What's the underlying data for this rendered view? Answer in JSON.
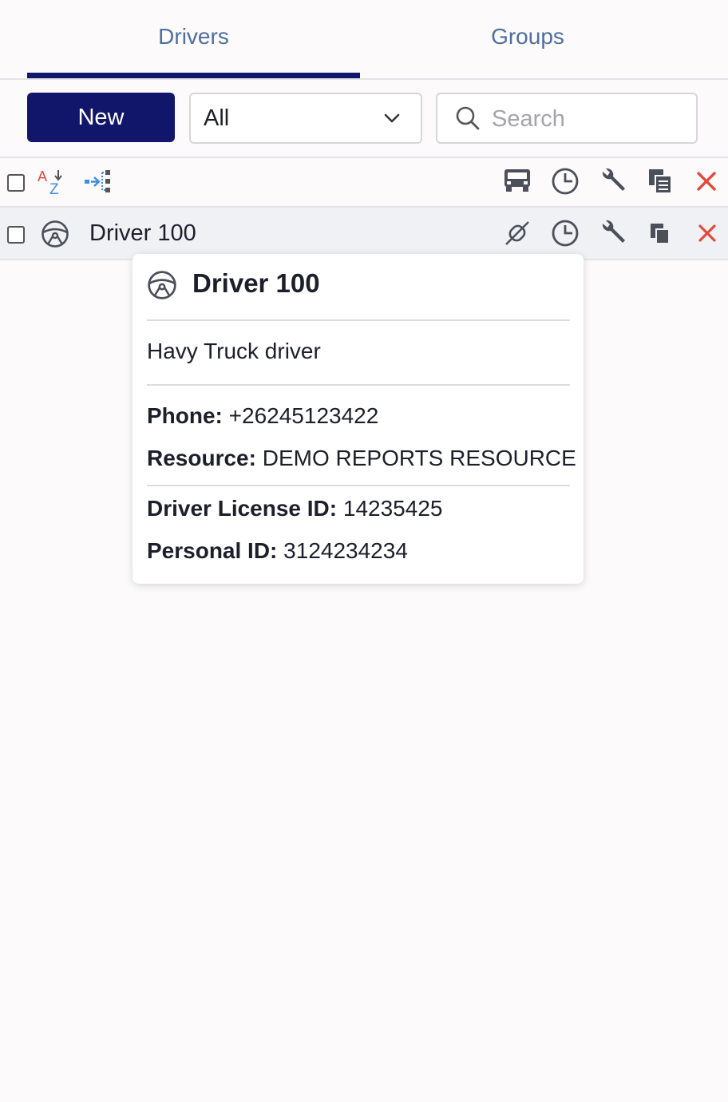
{
  "tabs": [
    {
      "label": "Drivers",
      "active": true
    },
    {
      "label": "Groups",
      "active": false
    }
  ],
  "toolbar": {
    "new_label": "New",
    "filter_value": "All",
    "search_placeholder": "Search"
  },
  "list": {
    "rows": [
      {
        "name": "Driver 100"
      }
    ]
  },
  "tooltip": {
    "title": "Driver 100",
    "description": "Havy Truck driver",
    "fields": [
      {
        "label": "Phone:",
        "value": " +26245123422"
      },
      {
        "label": "Resource:",
        "value": " DEMO REPORTS RESOURCE"
      },
      {
        "label": "Driver License ID:",
        "value": " 14235425"
      },
      {
        "label": "Personal ID:",
        "value": " 3124234234"
      }
    ]
  },
  "colors": {
    "accent": "#11166a",
    "tab_text": "#4f6f9f",
    "delete": "#e04a3c",
    "sort_icon_blue": "#3d8fe0",
    "sort_icon_red": "#e04a3c"
  }
}
